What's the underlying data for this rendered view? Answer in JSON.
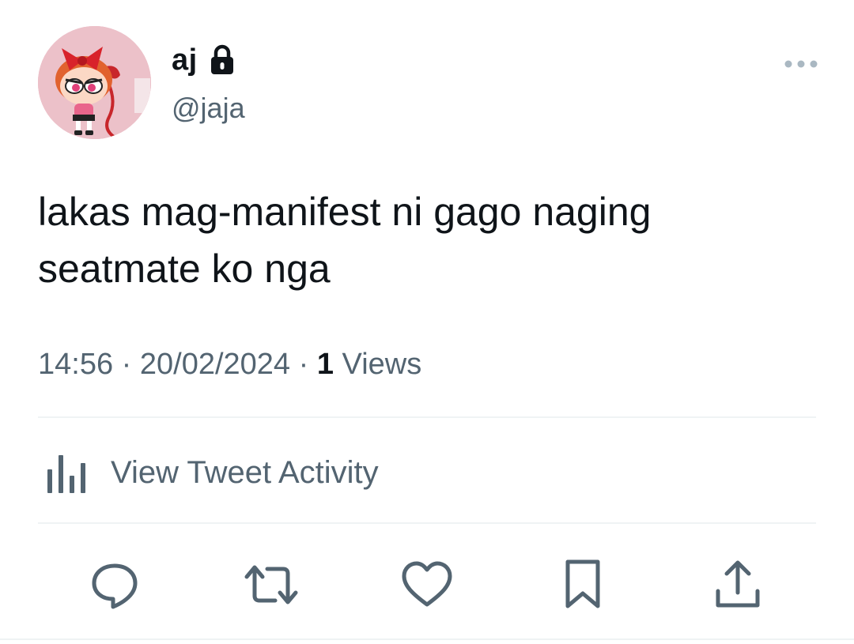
{
  "author": {
    "display_name": "aj",
    "handle": "@jaja",
    "protected_icon": "lock-icon",
    "avatar_icon": "powerpuff-blossom-avatar"
  },
  "tweet": {
    "text": "lakas mag-manifest ni gago naging\nseatmate ko nga"
  },
  "meta": {
    "time": "14:56",
    "separator": "·",
    "date": "20/02/2024",
    "views_count": "1",
    "views_label": "Views"
  },
  "activity": {
    "label": "View Tweet Activity",
    "icon": "bar-chart-icon"
  },
  "actions": [
    {
      "name": "reply",
      "icon": "reply-icon"
    },
    {
      "name": "retweet",
      "icon": "retweet-icon"
    },
    {
      "name": "like",
      "icon": "heart-icon"
    },
    {
      "name": "bookmark",
      "icon": "bookmark-icon"
    },
    {
      "name": "share",
      "icon": "share-icon"
    }
  ],
  "colors": {
    "text_primary": "#0f1419",
    "text_secondary": "#536471",
    "divider": "#eff3f4",
    "avatar_bg": "#e9b9c3"
  }
}
